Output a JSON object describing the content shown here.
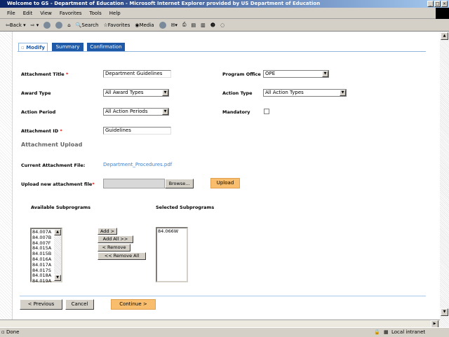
{
  "window": {
    "title": "Welcome to GS - Department of Education - Microsoft Internet Explorer provided by US Department of Education"
  },
  "menu": [
    "File",
    "Edit",
    "View",
    "Favorites",
    "Tools",
    "Help"
  ],
  "toolbar": {
    "back": "Back",
    "search": "Search",
    "favorites": "Favorites",
    "media": "Media"
  },
  "tabs": [
    {
      "label": "Modify",
      "active": true
    },
    {
      "label": "Summary"
    },
    {
      "label": "Confirmation"
    }
  ],
  "form": {
    "attachment_title_label": "Attachment Title",
    "attachment_title_value": "Department Guidelines",
    "program_office_label": "Program Office",
    "program_office_value": "OPE",
    "award_type_label": "Award Type",
    "award_type_value": "All Award Types",
    "action_type_label": "Action Type",
    "action_type_value": "All Action Types",
    "action_period_label": "Action Period",
    "action_period_value": "All Action Periods",
    "mandatory_label": "Mandatory",
    "mandatory_checked": false,
    "attachment_id_label": "Attachment ID",
    "attachment_id_value": "Guidelines",
    "required_mark": "*"
  },
  "upload": {
    "heading": "Attachment Upload",
    "current_label": "Current Attachment File:",
    "current_file": "Department_Procedures.pdf",
    "new_label": "Upload new attachment file",
    "browse": "Browse...",
    "upload": "Upload"
  },
  "subprograms": {
    "available_label": "Available Subprograms",
    "selected_label": "Selected Subprograms",
    "available": [
      "84.007A",
      "84.007B",
      "84.007F",
      "84.015A",
      "84.015B",
      "84.016A",
      "84.017A",
      "84.017S",
      "84.018A",
      "84.019A"
    ],
    "selected": [
      "84.066W"
    ],
    "add": "Add >",
    "add_all": "Add All >>",
    "remove": "< Remove",
    "remove_all": "<< Remove All"
  },
  "nav": {
    "previous": "< Previous",
    "cancel": "Cancel",
    "continue": "Continue >"
  },
  "status": {
    "text": "Done",
    "zone": "Local intranet"
  },
  "colors": {
    "tab": "#1f5aa8",
    "accent_button": "#f8be6e",
    "link": "#3a7fd0"
  }
}
